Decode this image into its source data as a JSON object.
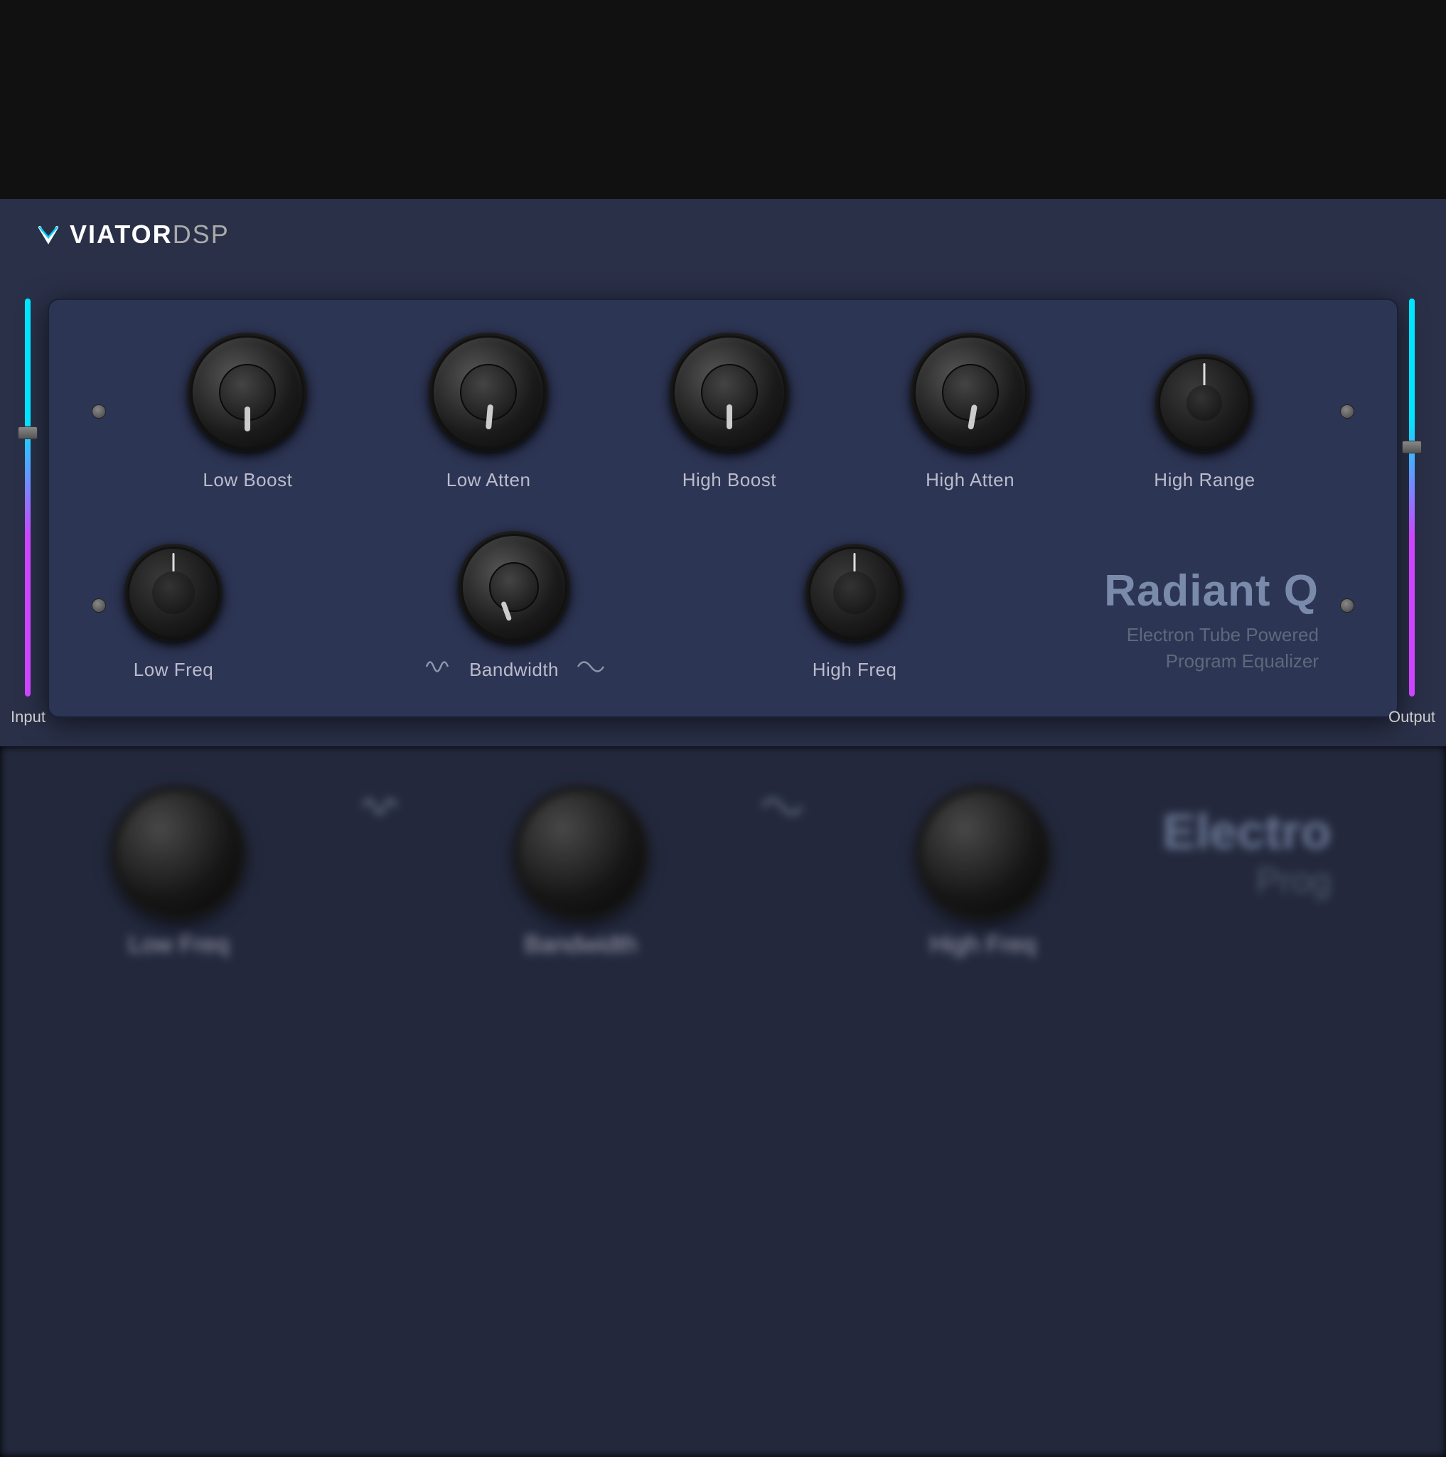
{
  "app": {
    "brand": "VIATOR",
    "brand_suffix": "DSP",
    "title": "Radiant Q",
    "subtitle": "Electron Tube Powered\nProgram Equalizer"
  },
  "sliders": {
    "input": {
      "label": "Input",
      "position": 180
    },
    "output": {
      "label": "Output",
      "position": 200
    }
  },
  "knobs_row1": [
    {
      "id": "low-boost",
      "label": "Low Boost",
      "type": "large",
      "rotation": -25
    },
    {
      "id": "low-atten",
      "label": "Low Atten",
      "type": "large",
      "rotation": 5
    },
    {
      "id": "high-boost",
      "label": "High Boost",
      "type": "large",
      "rotation": 0
    },
    {
      "id": "high-atten",
      "label": "High Atten",
      "type": "large",
      "rotation": 10
    },
    {
      "id": "high-range",
      "label": "High Range",
      "type": "pointer",
      "rotation": 0
    }
  ],
  "knobs_row2": [
    {
      "id": "low-freq",
      "label": "Low Freq",
      "type": "pointer",
      "rotation": 0
    },
    {
      "id": "bandwidth",
      "label": "Bandwidth",
      "type": "large-small",
      "rotation": -20
    },
    {
      "id": "high-freq",
      "label": "High Freq",
      "type": "pointer",
      "rotation": 0
    }
  ],
  "blurred_bottom": {
    "items": [
      {
        "label": "Low Freq"
      },
      {
        "label": "Bandwidth"
      },
      {
        "label": "High Freq"
      }
    ],
    "radiant_text": "Electro",
    "prog_text": "Prog"
  }
}
